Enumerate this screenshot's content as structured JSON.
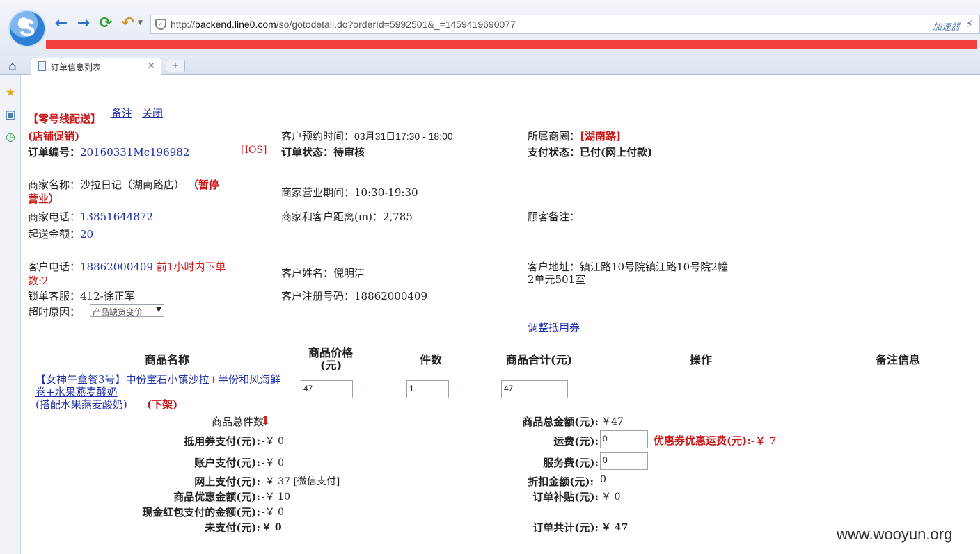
{
  "browser": {
    "address": {
      "prefix": "http://",
      "host": "backend.line0.com",
      "path": "/so/gotodetail.do?orderId=5992501&_=1459419690077"
    },
    "accelerator_label": "加速器",
    "tab_title": "订单信息列表",
    "new_tab": "+",
    "nav": {
      "back": "←",
      "forward": "→",
      "refresh": "⟳",
      "undo": "↶"
    }
  },
  "order": {
    "delivery_tag": "【零号线配送】",
    "remark_link": "备注",
    "close_link": "关闭",
    "promo_tag": "(店铺促销)",
    "appointment_label": "客户预约时间：",
    "appointment_value": "03月31日17:30 - 18:00",
    "district_label": "所属商圈：",
    "district_value": "[湖南路]",
    "order_no_label": "订单编号：",
    "order_no_value": "20160331Mc196982",
    "platform": "[IOS]",
    "order_status_label": "订单状态：",
    "order_status_value": "待审核",
    "pay_status_label": "支付状态：",
    "pay_status_value": "已付(网上付款)",
    "merchant_name_label": "商家名称：",
    "merchant_name_value": "沙拉日记（湖南路店）",
    "merchant_suspended_1": "（暂停",
    "merchant_suspended_2": "营业）",
    "business_hours_label": "商家营业期间：",
    "business_hours_value": "10:30-19:30",
    "merchant_phone_label": "商家电话：",
    "merchant_phone_value": "13851644872",
    "distance_label": "商家和客户距离(m)：",
    "distance_value": "2,785",
    "customer_note_label": "顾客备注：",
    "min_amount_label": "起送金额：",
    "min_amount_value": "20",
    "customer_phone_label": "客户电话：",
    "customer_phone_value": "18862000409",
    "recent_orders_1": "前1小时内下单",
    "recent_orders_2": "数:2",
    "customer_name_label": "客户姓名：",
    "customer_name_value": "倪明洁",
    "customer_addr_label": "客户地址：",
    "customer_addr_line1": "镇江路10号院镇江路10号院2幢",
    "customer_addr_line2": "2单元501室",
    "lock_service_label": "锁单客服：",
    "lock_service_value": "412-徐正军",
    "reg_no_label": "客户注册号码：",
    "reg_no_value": "18862000409",
    "timeout_label": "超时原因：",
    "timeout_value": "产品缺货变价",
    "adjust_coupon_link": "调整抵用券"
  },
  "table": {
    "headers": {
      "name": "商品名称",
      "price_1": "商品价格",
      "price_2": "(元)",
      "qty": "件数",
      "subtotal": "商品合计(元)",
      "ops": "操作",
      "note": "备注信息"
    },
    "row": {
      "name_1": "【女神午盒餐3号】中份宝石小镇沙拉+半份和风海鲜",
      "name_2": "卷+水果燕麦酸奶",
      "name_3": "(搭配水果燕麦酸奶)",
      "off_shelf": "(下架)",
      "price": "47",
      "qty": "1",
      "subtotal": "47"
    }
  },
  "summary": {
    "total_count_label": "商品总件数:",
    "total_count_value": "1",
    "coupon_pay_label": "抵用券支付(元):",
    "coupon_pay_value": "-￥ 0",
    "account_pay_label": "账户支付(元):",
    "account_pay_value": "-￥ 0",
    "online_pay_label": "网上支付(元):",
    "online_pay_value": "-￥ 37 [微信支付]",
    "discount_label": "商品优惠金额(元):",
    "discount_value": "-￥ 10",
    "redpacket_label": "现金红包支付的金额(元):",
    "redpacket_value": "-￥ 0",
    "unpaid_label": "未支付(元):",
    "unpaid_value": "￥ 0",
    "total_amount_label": "商品总金额(元):",
    "total_amount_value": "￥47",
    "freight_label": "运费(元):",
    "freight_value": "0",
    "freight_coupon": "优惠券优惠运费(元):-￥ 7",
    "service_fee_label": "服务费(元):",
    "service_fee_value": "0",
    "rebate_label": "折扣金额(元):",
    "rebate_value": "0",
    "subsidy_label": "订单补贴(元):",
    "subsidy_value": "￥ 0",
    "grand_total_label": "订单共计(元):",
    "grand_total_value": "￥ 47"
  },
  "watermark": "www.wooyun.org"
}
